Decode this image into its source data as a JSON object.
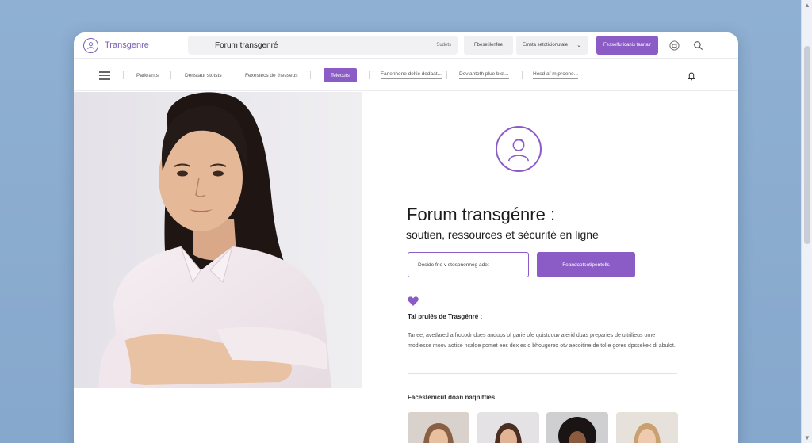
{
  "browser": {
    "brand_name": "Transgenre",
    "url_title": "Forum transgenré",
    "url_tag": "Sudets",
    "btn_feedback": "Fbesetilenfee",
    "btn_dropdown": "Emsta setoticionutale",
    "btn_primary": "Fesselfuricanis tannair"
  },
  "nav": {
    "items": [
      "Parkrants",
      "Denstaut stotsts",
      "Fexestecs de thesseus",
      "Telecuts",
      "Fanenhene deltic dedaat...",
      "Deviantoth plue bict...",
      "Hesd af m proene..."
    ]
  },
  "main": {
    "title": "Forum transgénre :",
    "subtitle": "soutien, ressources et sécurité en ligne",
    "search_placeholder": "Deside fne v stosonenneg adet",
    "cta_label": "Feandcotsotipentells",
    "section_title": "Tai pruiés de Trasgénré :",
    "paragraph": "Tanee, avetlared a frocodr dues andups ol garie ofe quistdouv alerid duas preparies de ultrilieus ome modlesse moov aotise ncaloe pomet ees dex es o bhougerex otv aecoitine de tol e gores dpssekek di abulot.",
    "features_title": "Facestenicut doan naqnitties"
  },
  "colors": {
    "accent": "#8b5cc6",
    "background": "#8fb0d2"
  },
  "icons": {
    "brand": "person-circle-icon",
    "cart": "basket-icon",
    "search": "search-icon",
    "menu": "hamburger-icon",
    "bell": "bell-icon",
    "heart": "heart-icon",
    "avatar": "person-avatar-icon"
  }
}
